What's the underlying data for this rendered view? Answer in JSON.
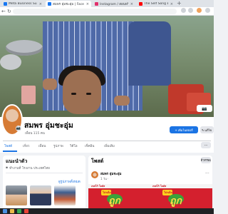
{
  "browser": {
    "tabs": [
      {
        "label": "Meta Business Suite",
        "favicon_color": "#1877f2",
        "active": false
      },
      {
        "label": "สมพร อุ่มชะอุ่ม | Facebook",
        "favicon_color": "#1877f2",
        "active": true
      },
      {
        "label": "Instagram / สอนฟรีโดย ติดตาม...",
        "favicon_color": "#e1306c",
        "active": false
      },
      {
        "label": "The Self Song Bedtime...",
        "favicon_color": "#ff0000",
        "active": false
      }
    ],
    "close_glyph": "×",
    "new_tab_glyph": "+"
  },
  "profile": {
    "name": "สมพร อุ่มชะอุ่ม",
    "friends": "เพื่อน 115 คน",
    "buttons": {
      "add_story": "เพิ่มในสตอรี่",
      "edit_profile": "แก้ไข"
    },
    "tabs": [
      "โพสต์",
      "เกี่ยว",
      "เพื่อน",
      "รูปภาพ",
      "วิดีโอ",
      "เช็คอิน",
      "เพิ่มเติม"
    ],
    "more_glyph": "···"
  },
  "intro": {
    "title": "แนะนำตัว",
    "line": "ทำงานที่ โรงงาน ประเทศไทย",
    "see_all_photos": "ดูรูปภาพทั้งหมด"
  },
  "posts": {
    "title": "โพสต์",
    "filter_label": "ตัวกรอง",
    "post": {
      "author": "สมพร อุ่มชะอุ่ม",
      "time": "1 วัน ·",
      "menu_glyph": "···",
      "image_texts": {
        "brand": "เทสโก้ โลตัส",
        "headline": "ถูก",
        "banner": "โปรเด็ด"
      }
    }
  },
  "colors": {
    "fb_blue": "#1b74e4",
    "promo_red": "#d4202e",
    "promo_yellow": "#ffe14a"
  },
  "icons": {
    "back": "back-arrow-icon",
    "forward": "forward-arrow-icon",
    "reload": "reload-icon",
    "camera": "camera-icon",
    "pencil": "pencil-icon",
    "plus": "plus-icon"
  }
}
